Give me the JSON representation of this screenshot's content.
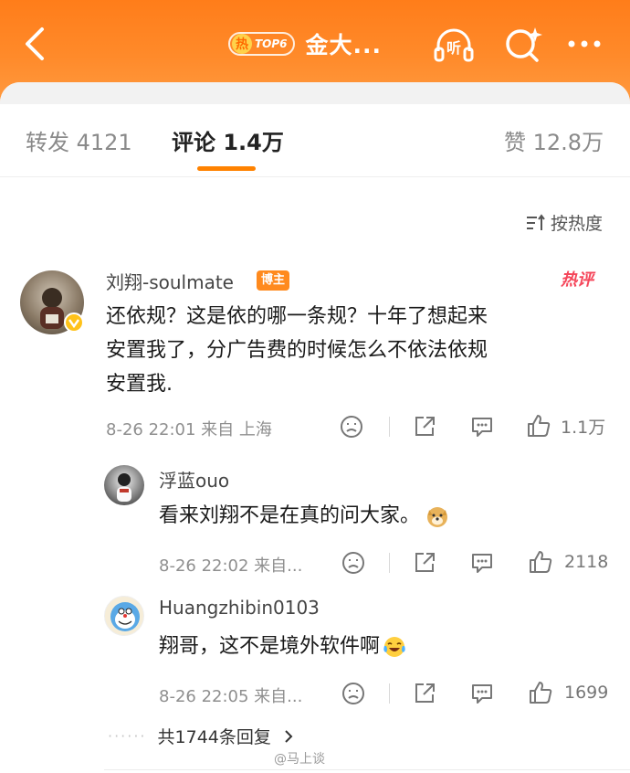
{
  "header": {
    "hot_char": "热",
    "badge": "TOP6",
    "title": "金大..."
  },
  "tabs": {
    "repost": "转发 4121",
    "comment": "评论 1.4万",
    "like": "赞 12.8万"
  },
  "sort_label": "按热度",
  "main_comment": {
    "username": "刘翔-soulmate",
    "badge": "博主",
    "hot_label": "热评",
    "text_line1": "还依规？这是依的哪一条规？十年了想起来",
    "text_line2": "安置我了，分广告费的时候怎么不依法依规",
    "text_line3": "安置我.",
    "time": "8-26 22:01 来自 上海",
    "likes": "1.1万"
  },
  "replies": [
    {
      "username": "浮蓝ouo",
      "text": "看来刘翔不是在真的问大家。",
      "time": "8-26 22:02 来自...",
      "likes": "2118"
    },
    {
      "username": "Huangzhibin0103",
      "text": "翔哥，这不是境外软件啊",
      "time": "8-26 22:05 来自...",
      "likes": "1699"
    }
  ],
  "more_replies": "共1744条回复",
  "more_dots": "······",
  "watermark": "@马上谈",
  "icons": [
    "back-icon",
    "listen-icon",
    "search-icon",
    "more-icon",
    "sort-icon",
    "emoji-face-icon",
    "share-icon",
    "comment-icon",
    "thumb-up-icon",
    "chevron-right-icon"
  ],
  "colors": {
    "accent": "#ff8200",
    "hot_red": "#f5465a",
    "header": "#ff8a2a"
  }
}
